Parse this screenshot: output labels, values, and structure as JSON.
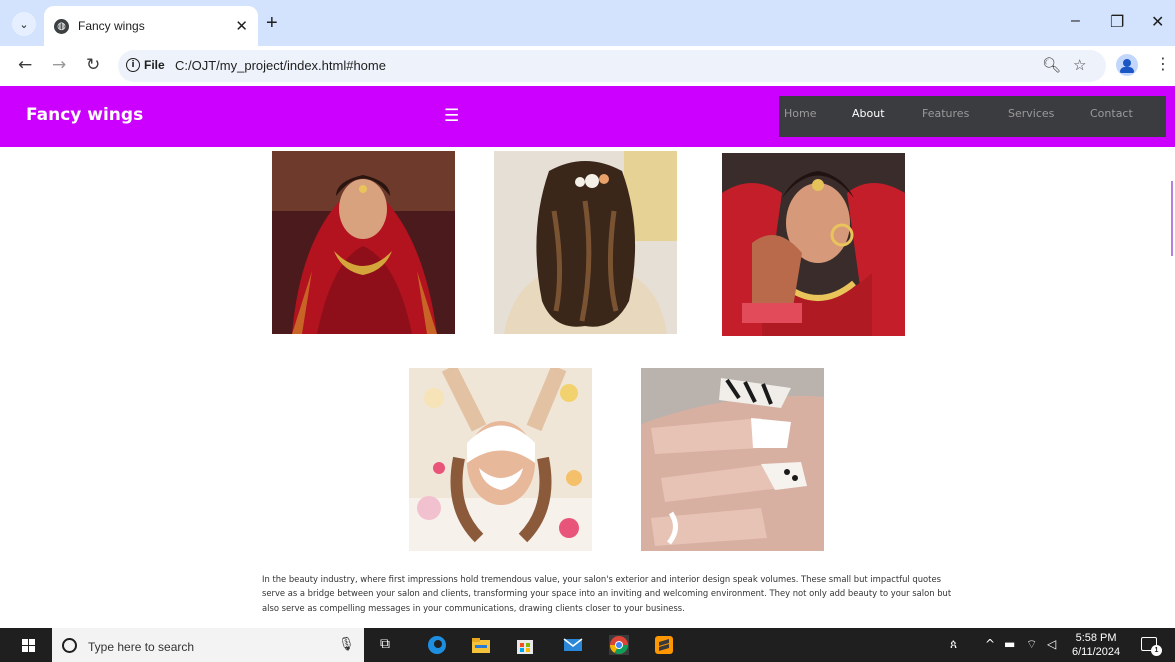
{
  "browser": {
    "tab_title": "Fancy wings",
    "omnibox_scheme_label": "File",
    "url": "C:/OJT/my_project/index.html#home",
    "icons": [
      "tab-list-icon",
      "globe-icon",
      "close-icon",
      "plus-icon",
      "minimize-icon",
      "restore-icon",
      "back-icon",
      "forward-icon",
      "reload-icon",
      "info-icon",
      "zoom-icon",
      "star-icon",
      "profile-icon",
      "menu-kebab-icon"
    ]
  },
  "site": {
    "brand": "Fancy wings",
    "nav_bg": "#cc00ff",
    "menu_bg": "#3b3c40",
    "menu": [
      {
        "label": "Home",
        "active": false
      },
      {
        "label": "About",
        "active": true
      },
      {
        "label": "Features",
        "active": false
      },
      {
        "label": "Services",
        "active": false
      },
      {
        "label": "Contact",
        "active": false
      }
    ],
    "gallery": [
      {
        "name": "bridal-red-lehenga-photo"
      },
      {
        "name": "bridal-curly-hairstyle-photo"
      },
      {
        "name": "bridal-jewelry-portrait-photo"
      },
      {
        "name": "facial-treatment-photo"
      },
      {
        "name": "nail-art-photo"
      }
    ],
    "description": "In the beauty industry, where first impressions hold tremendous value, your salon's exterior and interior design speak volumes. These small but impactful quotes serve as a bridge between your salon and clients, transforming your space into an inviting and welcoming environment. They not only add beauty to your salon but also serve as compelling messages in your communications, drawing clients closer to your business."
  },
  "taskbar": {
    "search_placeholder": "Type here to search",
    "time": "5:58 PM",
    "date": "6/11/2024",
    "notification_count": "1"
  }
}
